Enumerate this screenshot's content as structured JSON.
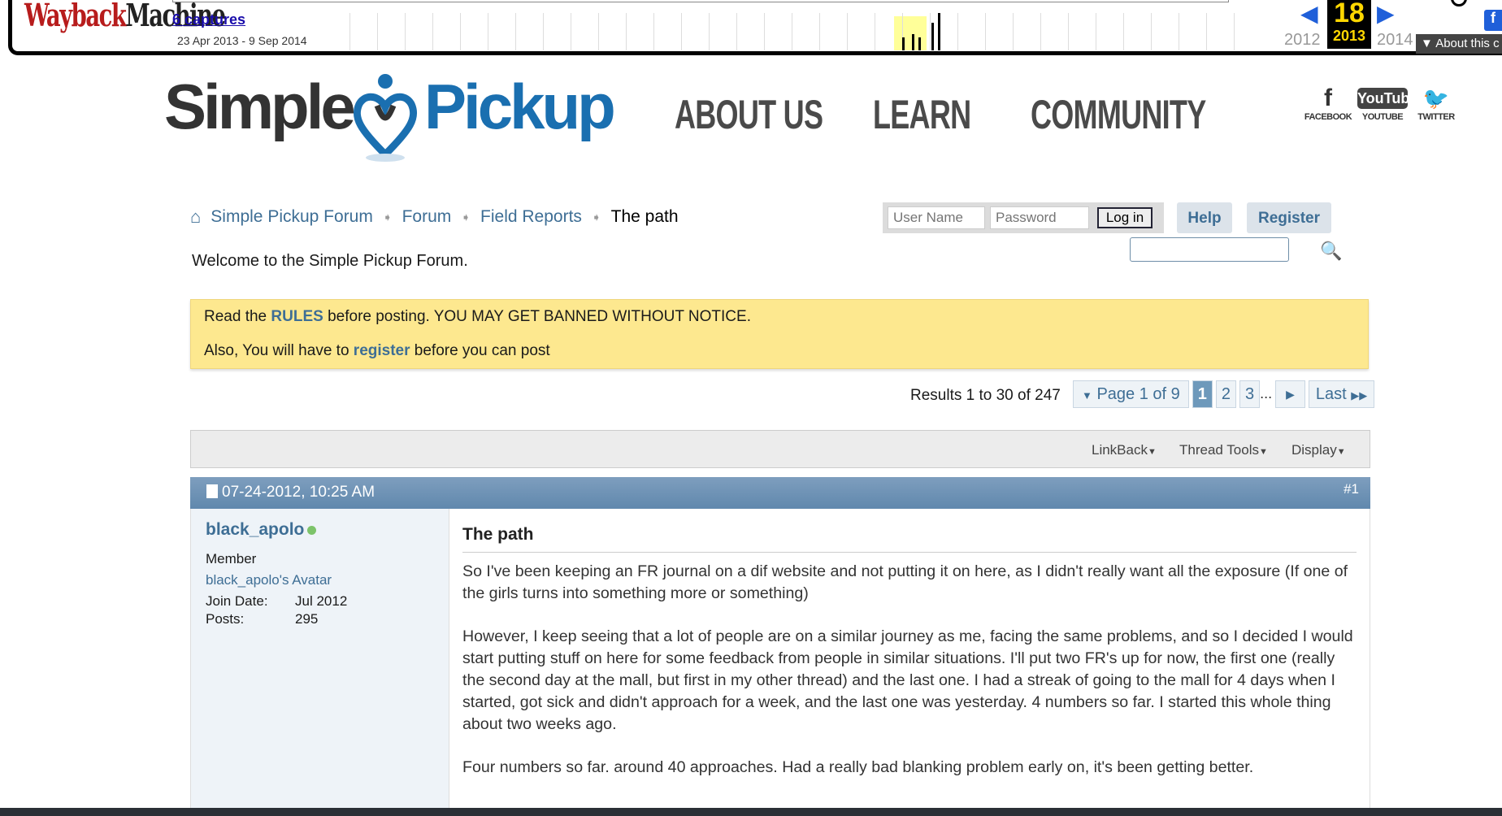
{
  "wayback": {
    "logo_part1": "Wayback",
    "logo_part2": "Machine",
    "captures": "6 captures",
    "range": "23 Apr 2013 - 9 Sep 2014",
    "year_prev": "2012",
    "year_cur": "2013",
    "year_next": "2014",
    "day": "18",
    "about": "About this c",
    "fb": "f"
  },
  "site": {
    "logo_left": "Simple",
    "logo_right": "Pickup",
    "nav": [
      "ABOUT US",
      "LEARN",
      "COMMUNITY"
    ],
    "social": [
      {
        "glyph": "f",
        "label": "FACEBOOK"
      },
      {
        "glyph": "YouTube",
        "label": "YOUTUBE"
      },
      {
        "glyph": "🐦",
        "label": "TWITTER"
      }
    ]
  },
  "breadcrumb": {
    "items": [
      "Simple Pickup Forum",
      "Forum",
      "Field Reports"
    ],
    "current": "The path"
  },
  "welcome": "Welcome to the Simple Pickup Forum.",
  "login": {
    "username_placeholder": "User Name",
    "password_placeholder": "Password",
    "login_label": "Log in",
    "help_label": "Help",
    "register_label": "Register"
  },
  "notice": {
    "line1_pre": "Read the ",
    "line1_link": "RULES",
    "line1_post": " before posting. YOU MAY GET BANNED WITHOUT NOTICE.",
    "line2_pre": "Also, You will have to ",
    "line2_link": "register",
    "line2_post": " before you can post"
  },
  "pagination": {
    "results": "Results 1 to 30 of 247",
    "page_label": "Page 1 of 9",
    "pages": [
      "1",
      "2",
      "3"
    ],
    "ellipsis": "...",
    "last": "Last"
  },
  "toolbar": {
    "linkback": "LinkBack",
    "thread_tools": "Thread Tools",
    "display": "Display"
  },
  "post": {
    "date": "07-24-2012, 10:25 AM",
    "number": "#1",
    "username": "black_apolo",
    "rank": "Member",
    "avatar_text": "black_apolo's Avatar",
    "join_label": "Join Date:",
    "join_value": "Jul 2012",
    "posts_label": "Posts:",
    "posts_value": "295",
    "title": "The path",
    "paragraphs": [
      "So I've been keeping an FR journal on a dif website and not putting it on here, as I didn't really want all the exposure (If one of the girls turns into something more or something)",
      "However, I keep seeing that a lot of people are on a similar journey as me, facing the same problems, and so I decided I would start putting stuff on here for some feedback from people in similar situations. I'll put two FR's up for now, the first one (really the second day at the mall, but first in my other thread) and the last one. I had a streak of going to the mall for 4 days when I started, got sick and didn't approach for a week, and the last one was yesterday. 4 numbers so far. I started this whole thing about two weeks ago.",
      "Four numbers so far. around 40 approaches. Had a really bad blanking problem early on, it's been getting better."
    ]
  }
}
